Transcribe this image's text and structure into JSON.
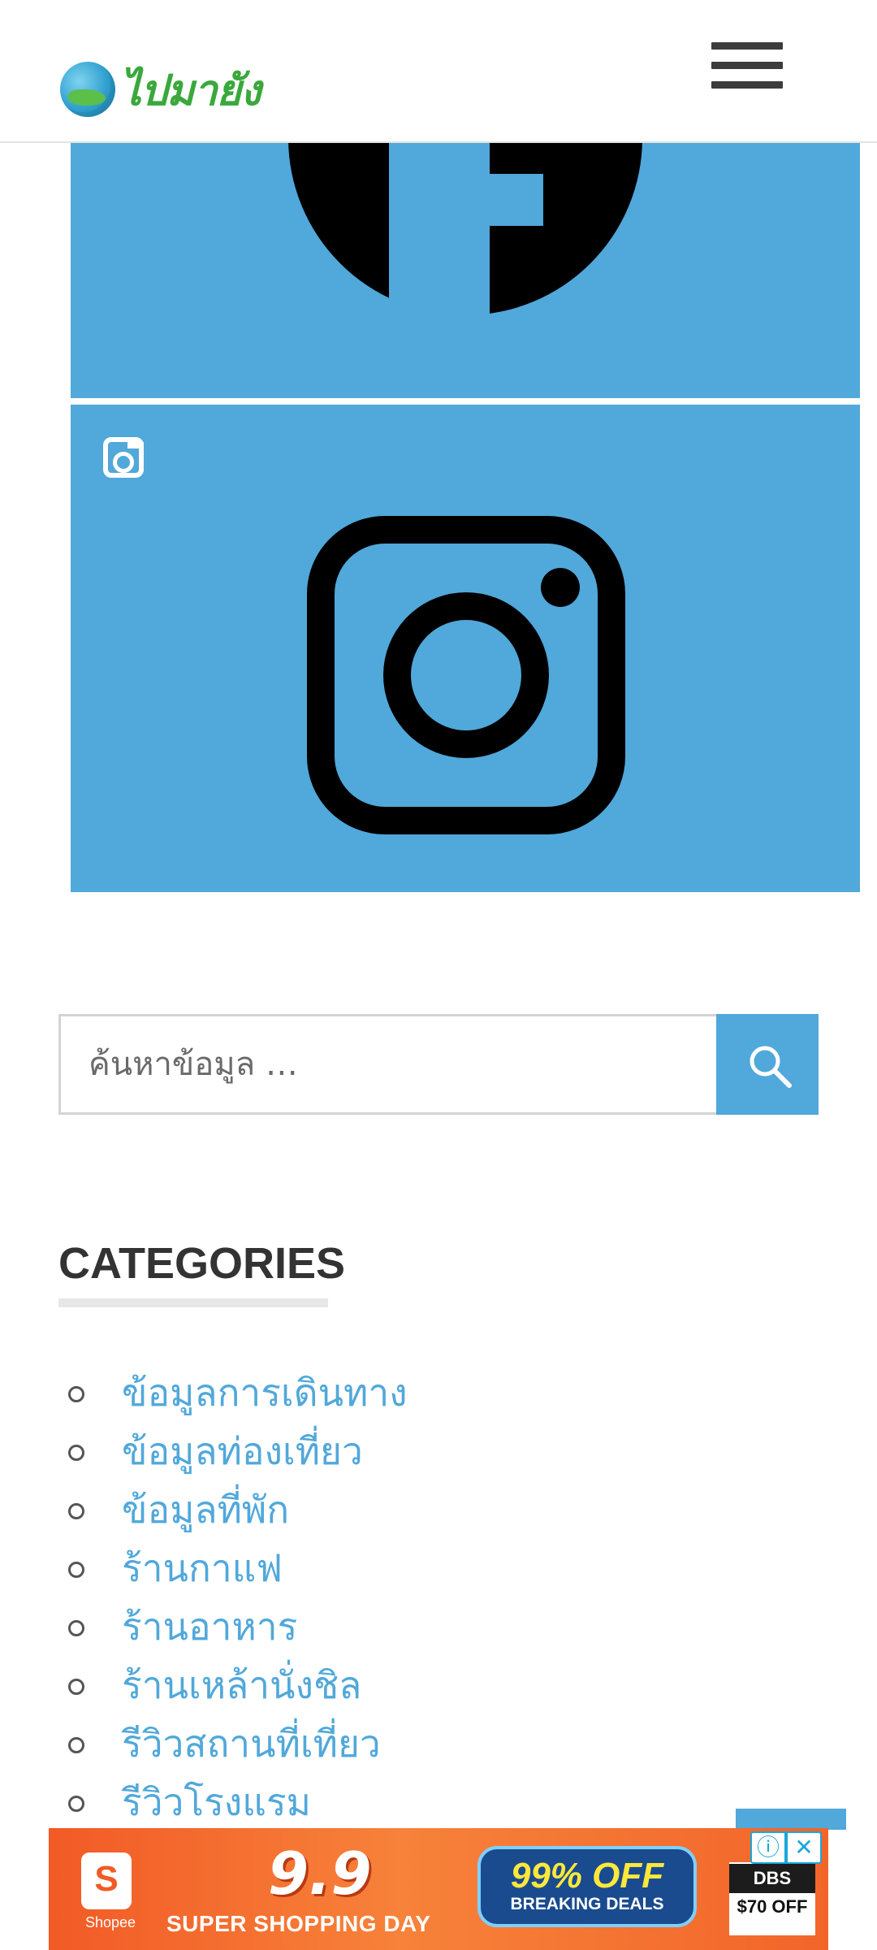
{
  "header": {
    "logo_text": "ไปมายัง",
    "menu_icon": "hamburger-menu-icon"
  },
  "social": {
    "facebook_icon": "facebook-icon",
    "instagram_icon": "instagram-icon",
    "colors": {
      "tile_bg": "#51a8da",
      "glyph": "#000000"
    }
  },
  "search": {
    "placeholder": "ค้นหาข้อมูล …",
    "button_icon": "search-icon"
  },
  "categories": {
    "title": "CATEGORIES",
    "items": [
      {
        "label": "ข้อมูลการเดินทาง"
      },
      {
        "label": "ข้อมูลท่องเที่ยว"
      },
      {
        "label": "ข้อมูลที่พัก"
      },
      {
        "label": "ร้านกาแฟ"
      },
      {
        "label": "ร้านอาหาร"
      },
      {
        "label": "ร้านเหล้านั่งชิล"
      },
      {
        "label": "รีวิวสถานที่เที่ยว"
      },
      {
        "label": "รีวิวโรงแรม"
      }
    ]
  },
  "ad": {
    "brand": "Shopee",
    "date_text": "9.9",
    "headline": "SUPER SHOPPING DAY",
    "deal_big": "99% OFF",
    "deal_small": "BREAKING DEALS",
    "partner": "DBS",
    "partner_offer": "$70 OFF",
    "info_icon": "info-icon",
    "close_icon": "close-icon"
  },
  "colors": {
    "accent": "#51a8da",
    "heading": "#333333",
    "logo_green": "#3aa83c",
    "ad_orange": "#f25a26"
  }
}
